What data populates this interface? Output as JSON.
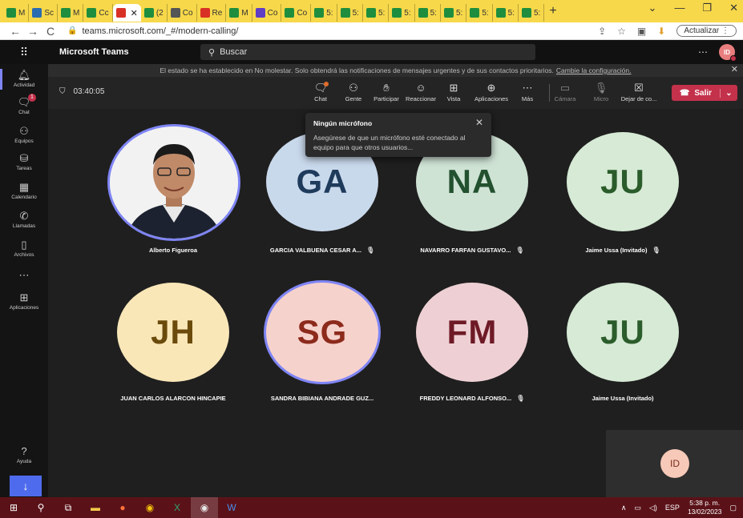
{
  "browser": {
    "tabs": [
      {
        "label": "M",
        "color": "#1e8e3e"
      },
      {
        "label": "Sc",
        "color": "#2b6cb0"
      },
      {
        "label": "M",
        "color": "#1e8e3e"
      },
      {
        "label": "Cc",
        "color": "#1e8e3e"
      },
      {
        "label": "",
        "color": "#d93025",
        "active": true
      },
      {
        "label": "(2",
        "color": "#1e8e3e"
      },
      {
        "label": "Co",
        "color": "#555555"
      },
      {
        "label": "Re",
        "color": "#d93025"
      },
      {
        "label": "M",
        "color": "#1e8e3e"
      },
      {
        "label": "Co",
        "color": "#5f3dc4"
      },
      {
        "label": "Co",
        "color": "#1e8e3e"
      },
      {
        "label": "5:",
        "color": "#1e8e3e"
      },
      {
        "label": "5:",
        "color": "#1e8e3e"
      },
      {
        "label": "5:",
        "color": "#1e8e3e"
      },
      {
        "label": "5:",
        "color": "#1e8e3e"
      },
      {
        "label": "5:",
        "color": "#1e8e3e"
      },
      {
        "label": "5:",
        "color": "#1e8e3e"
      },
      {
        "label": "5:",
        "color": "#1e8e3e"
      },
      {
        "label": "5:",
        "color": "#1e8e3e"
      },
      {
        "label": "5:",
        "color": "#1e8e3e"
      }
    ],
    "url": "teams.microsoft.com/_#/modern-calling/",
    "update_label": "Actualizar"
  },
  "teams": {
    "app_name": "Microsoft Teams",
    "search_placeholder": "Buscar",
    "user_initials": "ID",
    "rail": [
      {
        "label": "Actividad",
        "icon": "bell-icon"
      },
      {
        "label": "Chat",
        "icon": "chat-icon",
        "badge": "1"
      },
      {
        "label": "Equipos",
        "icon": "teams-icon"
      },
      {
        "label": "Tareas",
        "icon": "tasks-icon"
      },
      {
        "label": "Calendario",
        "icon": "calendar-icon"
      },
      {
        "label": "Llamadas",
        "icon": "phone-icon"
      },
      {
        "label": "Archivos",
        "icon": "file-icon"
      },
      {
        "label": "",
        "icon": "more-icon"
      },
      {
        "label": "Aplicaciones",
        "icon": "apps-icon"
      },
      {
        "label": "Ayuda",
        "icon": "help-icon"
      }
    ],
    "banner": {
      "text": "El estado se ha establecido en No molestar. Solo obtendrá las notificaciones de mensajes urgentes y de sus contactos prioritarios.",
      "link": "Cambie la configuración."
    }
  },
  "meeting": {
    "timer": "03:40:05",
    "toolbar": [
      {
        "label": "Chat",
        "icon": "chat-icon"
      },
      {
        "label": "Gente",
        "icon": "people-icon"
      },
      {
        "label": "Participar",
        "icon": "raise-hand-icon"
      },
      {
        "label": "Reaccionar",
        "icon": "smile-icon"
      },
      {
        "label": "Vista",
        "icon": "grid-view-icon"
      },
      {
        "label": "Aplicaciones",
        "icon": "add-apps-icon"
      },
      {
        "label": "Más",
        "icon": "more-icon"
      },
      {
        "label": "Cámara",
        "icon": "camera-off-icon"
      },
      {
        "label": "Micro",
        "icon": "mic-off-icon"
      },
      {
        "label": "Dejar de co...",
        "icon": "stop-share-icon"
      }
    ],
    "leave_label": "Salir",
    "tooltip": {
      "title": "Ningún micrófono",
      "body": "Asegúrese de que un micrófono esté conectado al equipo para que otros usuarios..."
    },
    "participants": [
      {
        "name": "Alberto Figueroa",
        "initials": "",
        "photo": true,
        "bg": "#f3f3f3",
        "fg": "#000000",
        "muted": false,
        "speaking": true
      },
      {
        "name": "GARCIA VALBUENA CESAR A...",
        "initials": "GA",
        "bg": "#c9d9ec",
        "fg": "#1f3b5c",
        "muted": true,
        "speaking": false
      },
      {
        "name": "NAVARRO FARFAN GUSTAVO...",
        "initials": "NA",
        "bg": "#cfe3d5",
        "fg": "#23512f",
        "muted": true,
        "speaking": false
      },
      {
        "name": "Jaime Ussa (Invitado)",
        "initials": "JU",
        "bg": "#d6ead6",
        "fg": "#2b5c2b",
        "muted": true,
        "speaking": false
      },
      {
        "name": "JUAN CARLOS ALARCON HINCAPIE",
        "initials": "JH",
        "bg": "#f9e7b8",
        "fg": "#6b4b0c",
        "muted": false,
        "speaking": false
      },
      {
        "name": "SANDRA BIBIANA ANDRADE GUZ...",
        "initials": "SG",
        "bg": "#f6d2cc",
        "fg": "#8c2a1c",
        "muted": false,
        "speaking": true
      },
      {
        "name": "FREDDY LEONARD ALFONSO...",
        "initials": "FM",
        "bg": "#eed0d4",
        "fg": "#6e1a26",
        "muted": true,
        "speaking": false
      },
      {
        "name": "Jaime Ussa (Invitado)",
        "initials": "JU",
        "bg": "#d6ead6",
        "fg": "#2b5c2b",
        "muted": false,
        "speaking": false
      }
    ],
    "self_initials": "ID"
  },
  "taskbar": {
    "lang": "ESP",
    "time": "5:38 p. m.",
    "date": "13/02/2023"
  }
}
